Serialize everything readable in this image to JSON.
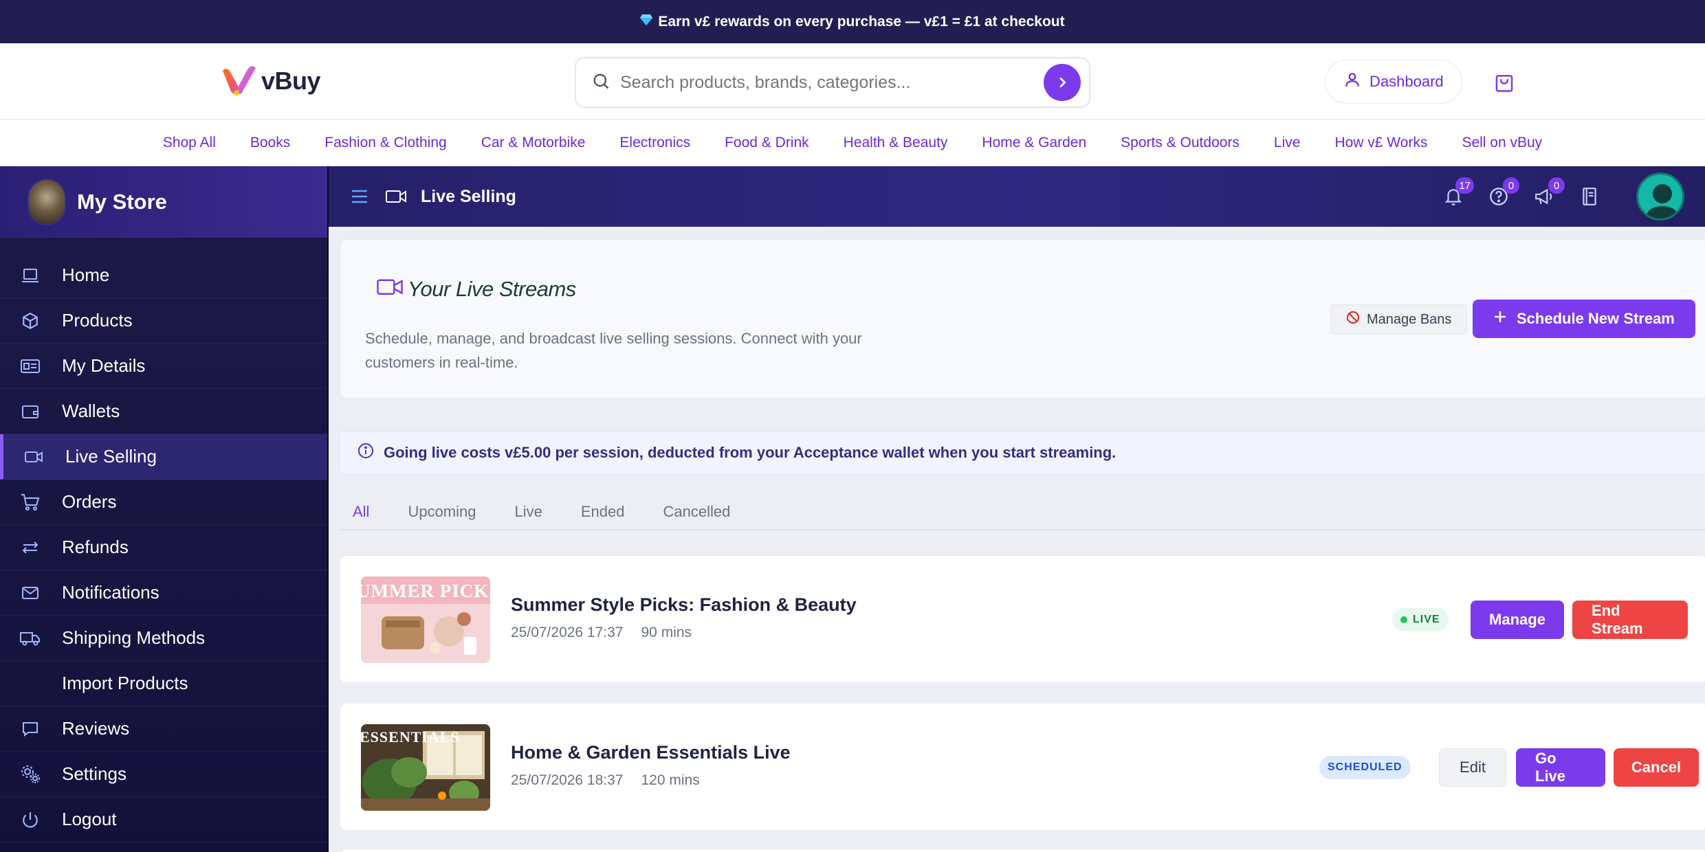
{
  "promo": {
    "icon": "gem-icon",
    "text": "Earn v£ rewards on every purchase — v£1 = £1 at checkout"
  },
  "header": {
    "logo_text": "vBuy",
    "search_placeholder": "Search products, brands, categories...",
    "dashboard_label": "Dashboard"
  },
  "categories": [
    "Shop All",
    "Books",
    "Fashion & Clothing",
    "Car & Motorbike",
    "Electronics",
    "Food & Drink",
    "Health & Beauty",
    "Home & Garden",
    "Sports & Outdoors",
    "Live",
    "How v£ Works",
    "Sell on vBuy"
  ],
  "sidebar": {
    "store_name": "My Store",
    "items": [
      {
        "label": "Home",
        "icon": "laptop-icon"
      },
      {
        "label": "Products",
        "icon": "box-icon"
      },
      {
        "label": "My Details",
        "icon": "id-card-icon"
      },
      {
        "label": "Wallets",
        "icon": "wallet-icon"
      },
      {
        "label": "Live Selling",
        "icon": "video-icon",
        "active": true
      },
      {
        "label": "Orders",
        "icon": "cart-icon"
      },
      {
        "label": "Refunds",
        "icon": "refund-icon"
      },
      {
        "label": "Notifications",
        "icon": "mail-icon"
      },
      {
        "label": "Shipping Methods",
        "icon": "truck-icon"
      },
      {
        "label": "Import Products",
        "icon": ""
      },
      {
        "label": "Reviews",
        "icon": "comment-icon"
      },
      {
        "label": "Settings",
        "icon": "settings-icon"
      },
      {
        "label": "Logout",
        "icon": "power-icon"
      }
    ]
  },
  "appbar": {
    "title": "Live Selling",
    "notifications_count": "17",
    "help_count": "0",
    "announcements_count": "0"
  },
  "hero": {
    "title": "Your Live Streams",
    "subtitle": "Schedule, manage, and broadcast live selling sessions. Connect with your customers in real-time.",
    "manage_bans_label": "Manage Bans",
    "schedule_label": "Schedule New Stream"
  },
  "info_text": "Going live costs v£5.00 per session, deducted from your Acceptance wallet when you start streaming.",
  "tabs": [
    "All",
    "Upcoming",
    "Live",
    "Ended",
    "Cancelled"
  ],
  "streams": [
    {
      "title": "Summer Style Picks: Fashion & Beauty",
      "date": "25/07/2026 17:37",
      "duration": "90 mins",
      "status": "LIVE",
      "thumb_text": "UMMER PICKS",
      "actions": [
        "Manage",
        "End Stream"
      ]
    },
    {
      "title": "Home & Garden Essentials Live",
      "date": "25/07/2026 18:37",
      "duration": "120 mins",
      "status": "SCHEDULED",
      "thumb_text": "ESSENTIALS",
      "actions": [
        "Edit",
        "Go Live",
        "Cancel"
      ]
    }
  ],
  "colors": {
    "brand_purple": "#7c3aed",
    "danger_red": "#ef4444",
    "sidebar_bg": "#1d1a48",
    "promo_bg": "#231e52"
  }
}
